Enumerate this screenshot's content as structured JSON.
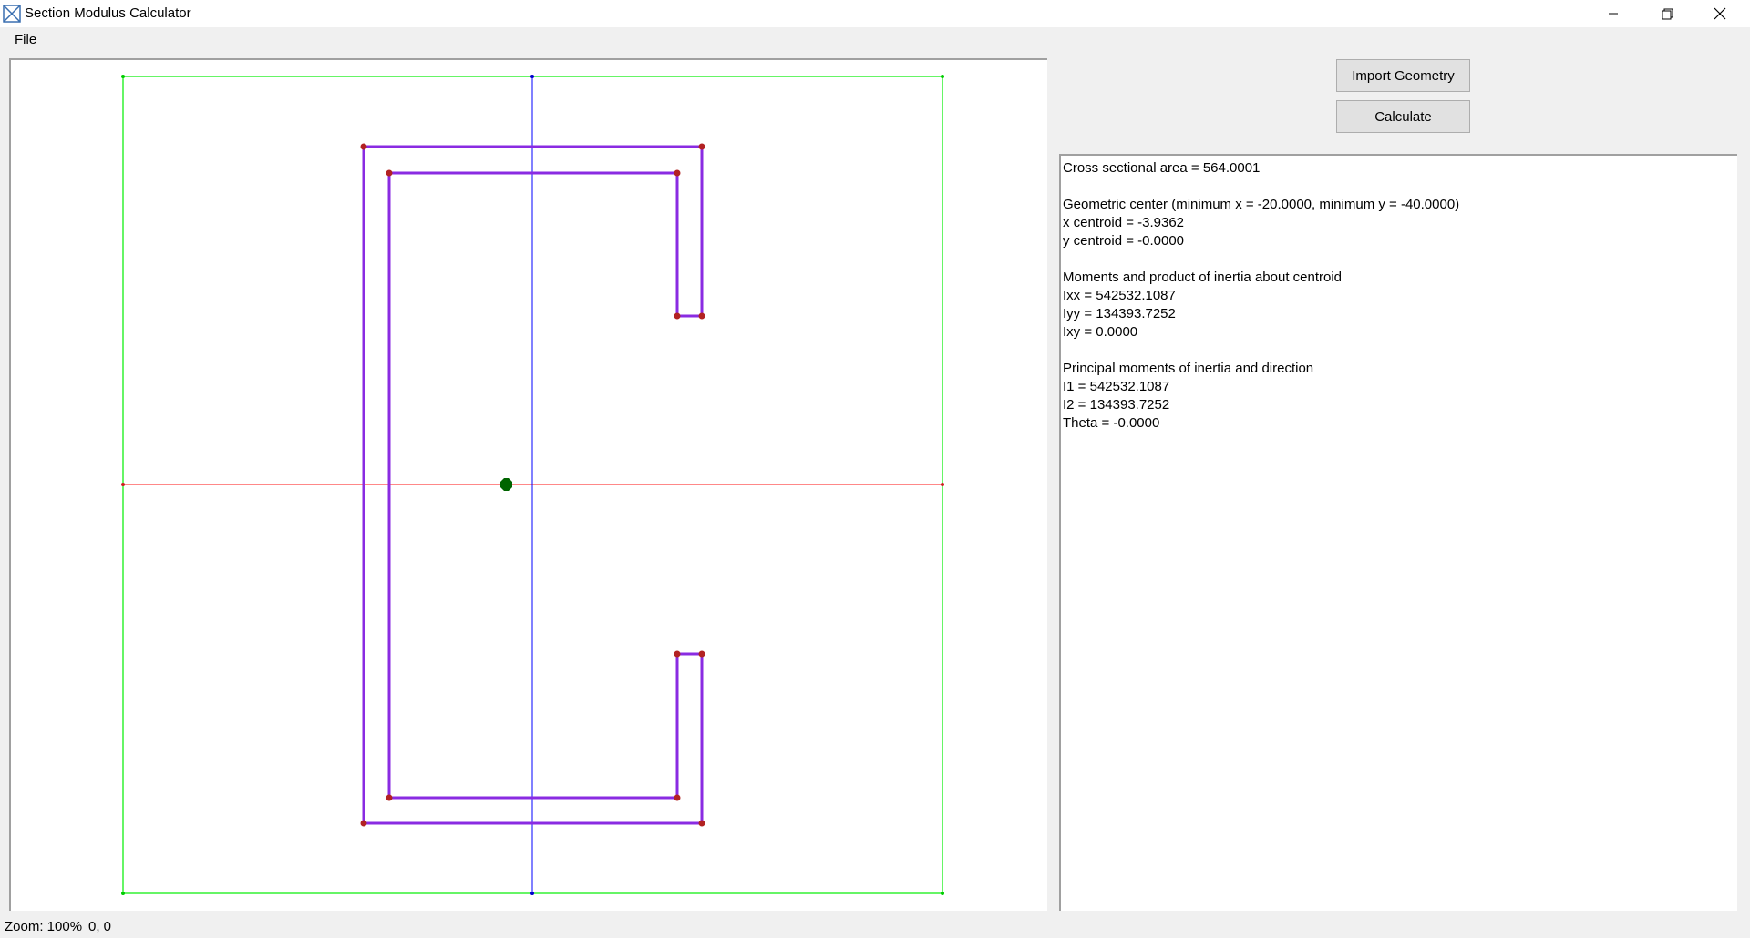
{
  "window": {
    "title": "Section Modulus Calculator",
    "controls": [
      "minimize",
      "restore",
      "close"
    ]
  },
  "menu": {
    "file_label": "File"
  },
  "buttons": {
    "import_label": "Import Geometry",
    "calculate_label": "Calculate"
  },
  "results": {
    "lines": [
      "Cross sectional area = 564.0001",
      "",
      "Geometric center (minimum x = -20.0000, minimum y = -40.0000)",
      "x centroid = -3.9362",
      "y centroid = -0.0000",
      "",
      "Moments and product of inertia about centroid",
      "Ixx = 542532.1087",
      "Iyy = 134393.7252",
      "Ixy = 0.0000",
      "",
      "Principal moments of inertia and direction",
      "I1 = 542532.1087",
      "I2 = 134393.7252",
      "Theta = -0.0000"
    ]
  },
  "status": {
    "zoom": "Zoom: 100%",
    "coords": "0, 0"
  },
  "colors": {
    "section_outline": "#8a2be2",
    "vertex": "#b22222",
    "bounding_box": "#00ee00",
    "x_axis": "#ff4040",
    "y_axis": "#0000ff",
    "centroid": "#006400"
  }
}
